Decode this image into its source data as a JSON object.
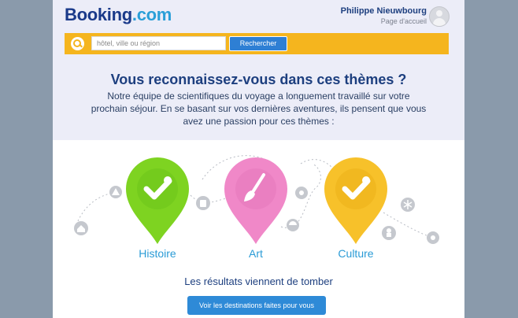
{
  "header": {
    "logo_part1": "Booking",
    "logo_part2": ".com",
    "user_name": "Philippe Nieuwbourg",
    "user_link": "Page d'accueil"
  },
  "search": {
    "placeholder": "hôtel, ville ou région",
    "button_label": "Rechercher"
  },
  "main": {
    "headline": "Vous reconnaissez-vous dans ces thèmes ?",
    "intro": "Notre équipe de scientifiques du voyage a longuement travaillé sur votre prochain séjour. En se basant sur vos dernières aventures, ils pensent que vous avez une passion pour ces thèmes :",
    "themes": [
      {
        "label": "Histoire",
        "color": "#7ed321",
        "icon": "check-icon"
      },
      {
        "label": "Art",
        "color": "#f088c8",
        "icon": "paintbrush-icon"
      },
      {
        "label": "Culture",
        "color": "#f7c12a",
        "icon": "check-icon"
      }
    ],
    "results_text": "Les résultats viennent de tomber",
    "cta_label": "Voir les destinations faites pour vous"
  },
  "colors": {
    "brand_dark": "#1d3f7f",
    "brand_light": "#2a9fd8",
    "search_bar": "#f5b51e",
    "button": "#2e7fd4"
  }
}
